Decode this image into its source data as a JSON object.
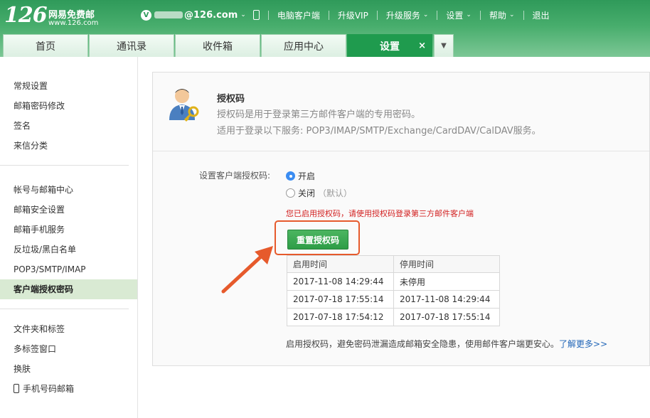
{
  "header": {
    "logo_number": "126",
    "logo_name": "网易免费邮",
    "logo_url": "www.126.com",
    "account_badge": "V",
    "account_domain": "@126.com",
    "top_links": [
      "电脑客户端",
      "升级VIP",
      "升级服务",
      "设置",
      "帮助",
      "退出"
    ],
    "top_links_with_caret": [
      "升级服务",
      "设置",
      "帮助"
    ]
  },
  "tabs": [
    "首页",
    "通讯录",
    "收件箱",
    "应用中心",
    "设置"
  ],
  "active_tab_close": "×",
  "sidebar": {
    "group1": [
      "常规设置",
      "邮箱密码修改",
      "签名",
      "来信分类"
    ],
    "group2": [
      "帐号与邮箱中心",
      "邮箱安全设置",
      "邮箱手机服务",
      "反垃圾/黑白名单",
      "POP3/SMTP/IMAP",
      "客户端授权密码"
    ],
    "group3": [
      "文件夹和标签",
      "多标签窗口",
      "换肤",
      "手机号码邮箱"
    ],
    "active_item": "客户端授权密码"
  },
  "auth": {
    "title": "授权码",
    "desc1": "授权码是用于登录第三方邮件客户端的专用密码。",
    "desc2": "适用于登录以下服务: POP3/IMAP/SMTP/Exchange/CardDAV/CalDAV服务。"
  },
  "settings": {
    "label": "设置客户端授权码:",
    "options": [
      {
        "label": "开启",
        "note": "",
        "checked": true
      },
      {
        "label": "关闭",
        "note": "（默认）",
        "checked": false
      }
    ],
    "warning": "您已启用授权码，请使用授权码登录第三方邮件客户端",
    "reset_button": "重置授权码"
  },
  "history": {
    "headers": [
      "启用时间",
      "停用时间"
    ],
    "rows": [
      [
        "2017-11-08 14:29:44",
        "未停用"
      ],
      [
        "2017-07-18 17:55:14",
        "2017-11-08 14:29:44"
      ],
      [
        "2017-07-18 17:54:12",
        "2017-07-18 17:55:14"
      ]
    ]
  },
  "footer": {
    "note": "启用授权码，避免密码泄漏造成邮箱安全隐患，使用邮件客户端更安心。",
    "link": "了解更多>>"
  },
  "colors": {
    "header_green": "#2f9a5a",
    "active_tab": "#1f9b4e",
    "button_green": "#2d9d46",
    "warning_red": "#d21f1f",
    "highlight_orange": "#e65a2c",
    "link_blue": "#2367b8"
  }
}
